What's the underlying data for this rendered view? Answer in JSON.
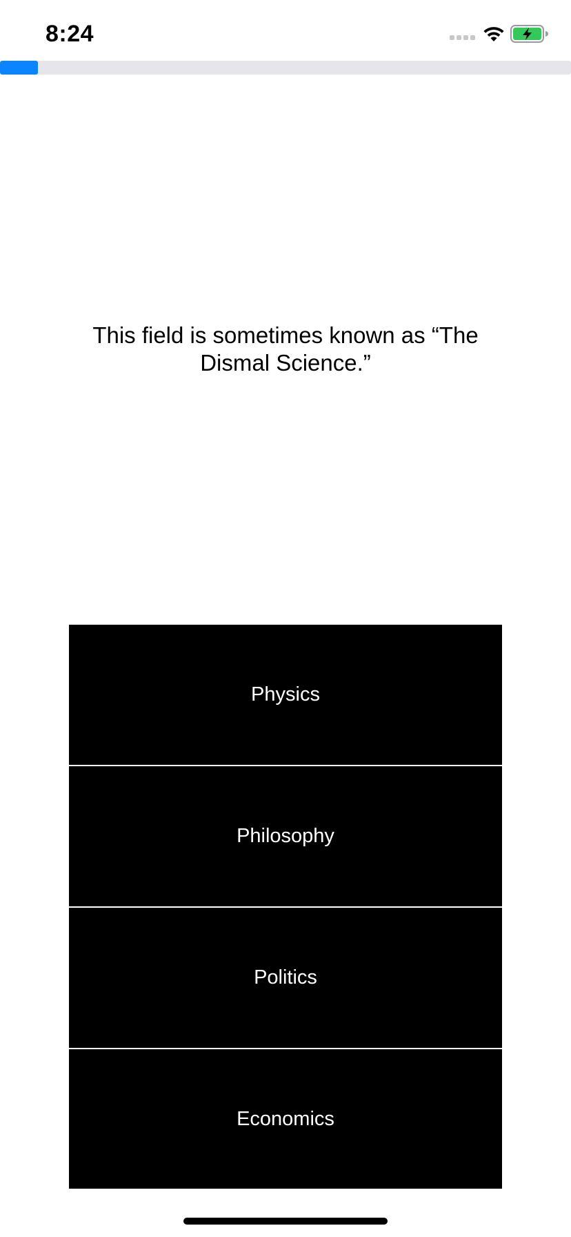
{
  "status_bar": {
    "time": "8:24",
    "icons": [
      "signal-dots-icon",
      "wifi-icon",
      "battery-charging-icon"
    ],
    "battery_color": "#34c759"
  },
  "progress": {
    "fraction": 0.067,
    "fill_color": "#0a84ff",
    "track_color": "#e5e5ea"
  },
  "question": {
    "text": "This field is sometimes known as “The Dismal Science.”"
  },
  "answers": [
    {
      "label": "Physics"
    },
    {
      "label": "Philosophy"
    },
    {
      "label": "Politics"
    },
    {
      "label": "Economics"
    }
  ]
}
